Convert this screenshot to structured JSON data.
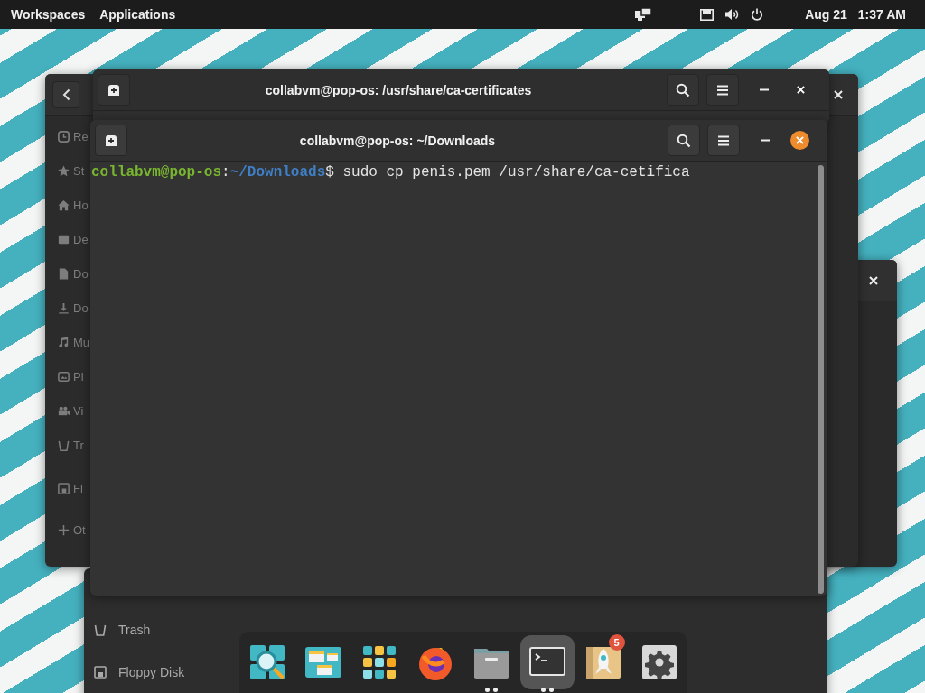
{
  "top_bar": {
    "menus": [
      {
        "label": "Workspaces"
      },
      {
        "label": "Applications"
      }
    ],
    "date": "Aug 21",
    "time": "1:37 AM"
  },
  "files_window": {
    "sidebar": [
      {
        "kind": "recent",
        "label": "Re"
      },
      {
        "kind": "starred",
        "label": "St"
      },
      {
        "kind": "home",
        "label": "Ho"
      },
      {
        "kind": "desktop",
        "label": "De"
      },
      {
        "kind": "documents",
        "label": "Do"
      },
      {
        "kind": "downloads",
        "label": "Do"
      },
      {
        "kind": "music",
        "label": "Mu"
      },
      {
        "kind": "pictures",
        "label": "Pi"
      },
      {
        "kind": "videos",
        "label": "Vi"
      },
      {
        "kind": "trash",
        "label": "Tr"
      },
      {
        "kind": "floppy",
        "label": "Fl"
      },
      {
        "kind": "other",
        "label": "Ot"
      }
    ]
  },
  "lower_files_window": {
    "sidebar": [
      {
        "kind": "trash",
        "label": "Trash"
      },
      {
        "kind": "floppy",
        "label": "Floppy Disk"
      }
    ]
  },
  "terminals": [
    {
      "title": "collabvm@pop-os: /usr/share/ca-certificates",
      "active": false
    },
    {
      "title": "collabvm@pop-os: ~/Downloads",
      "active": true,
      "line": [
        {
          "kind": "user",
          "text": "collabvm@pop-os"
        },
        {
          "kind": "plain",
          "text": ":"
        },
        {
          "kind": "path",
          "text": "~/Downloads"
        },
        {
          "kind": "plain",
          "text": "$ sudo cp penis.pem /usr/share/ca-cetifica"
        }
      ]
    }
  ],
  "dock": [
    {
      "kind": "search",
      "running": false,
      "selected": false
    },
    {
      "kind": "workspaces",
      "running": false,
      "selected": false
    },
    {
      "kind": "launcher",
      "running": false,
      "selected": false
    },
    {
      "kind": "browser",
      "running": false,
      "selected": false
    },
    {
      "kind": "files",
      "running": true,
      "selected": false
    },
    {
      "kind": "terminal",
      "running": true,
      "selected": true
    },
    {
      "kind": "shop",
      "running": false,
      "selected": false,
      "badge": "5"
    },
    {
      "kind": "settings",
      "running": false,
      "selected": false
    }
  ]
}
